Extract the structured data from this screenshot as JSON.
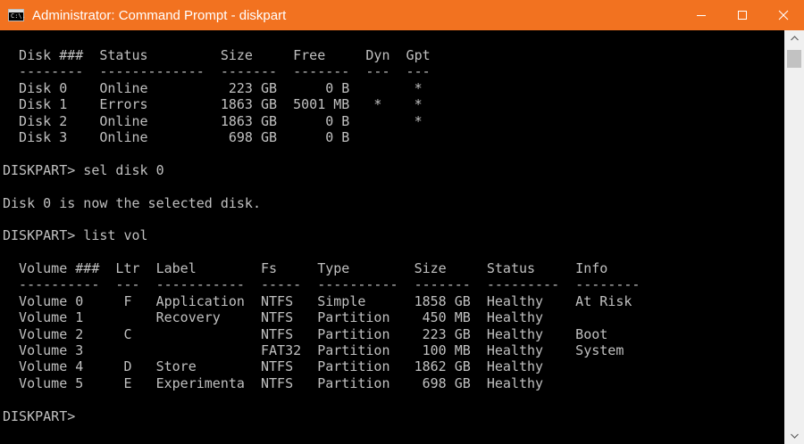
{
  "window": {
    "title": "Administrator: Command Prompt - diskpart",
    "icon": "cmd-icon",
    "icon_glyph": "C:\\.",
    "controls": [
      "minimize-icon",
      "maximize-icon",
      "close-icon"
    ]
  },
  "colors": {
    "titlebar": "#f27220",
    "console_bg": "#000000",
    "console_text": "#c0c0c0"
  },
  "console": {
    "lines": [
      "  Disk ###  Status         Size     Free     Dyn  Gpt",
      "  --------  -------------  -------  -------  ---  ---",
      "  Disk 0    Online          223 GB      0 B        *",
      "  Disk 1    Errors         1863 GB  5001 MB   *    *",
      "  Disk 2    Online         1863 GB      0 B        *",
      "  Disk 3    Online          698 GB      0 B",
      "",
      "DISKPART> sel disk 0",
      "",
      "Disk 0 is now the selected disk.",
      "",
      "DISKPART> list vol",
      "",
      "  Volume ###  Ltr  Label        Fs     Type        Size     Status     Info",
      "  ----------  ---  -----------  -----  ----------  -------  ---------  --------",
      "  Volume 0     F   Application  NTFS   Simple      1858 GB  Healthy    At Risk",
      "  Volume 1         Recovery     NTFS   Partition    450 MB  Healthy",
      "  Volume 2     C                NTFS   Partition    223 GB  Healthy    Boot",
      "  Volume 3                      FAT32  Partition    100 MB  Healthy    System",
      "  Volume 4     D   Store        NTFS   Partition   1862 GB  Healthy",
      "  Volume 5     E   Experimenta  NTFS   Partition    698 GB  Healthy",
      "",
      "DISKPART> "
    ]
  },
  "scrollbar": {
    "up_icon": "scroll-up-arrow-icon",
    "down_icon": "scroll-down-arrow-icon"
  }
}
